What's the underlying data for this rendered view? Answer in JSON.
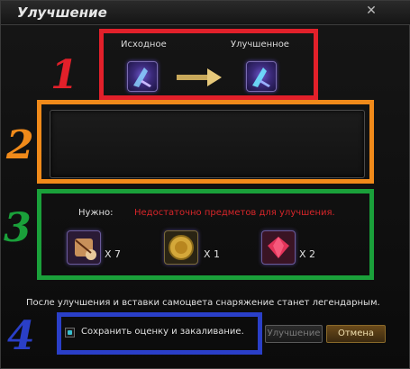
{
  "window": {
    "title": "Улучшение"
  },
  "transform": {
    "source_label": "Исходное",
    "upgraded_label": "Улучшенное",
    "source_icon": "weapon-icon",
    "upgraded_icon": "upgraded-weapon-icon"
  },
  "requirements": {
    "label": "Нужно:",
    "warning": "Недостаточно предметов для улучшения.",
    "items": [
      {
        "icon": "scroll-icon",
        "qty": "X 7"
      },
      {
        "icon": "gold-coin-icon",
        "qty": "X 1"
      },
      {
        "icon": "red-gem-icon",
        "qty": "X 2"
      }
    ]
  },
  "info_text": "После улучшения и вставки самоцвета снаряжение станет легендарным.",
  "options": {
    "keep_label": "Сохранить оценку и закаливание.",
    "keep_checked": true
  },
  "buttons": {
    "upgrade": "Улучшение",
    "cancel": "Отмена"
  },
  "annotations": [
    "1",
    "2",
    "3",
    "4"
  ],
  "colors": {
    "ann1": "#e2202a",
    "ann2": "#f08a1a",
    "ann3": "#1aa03a",
    "ann4": "#2a3fc8",
    "warning": "#d8262a"
  }
}
